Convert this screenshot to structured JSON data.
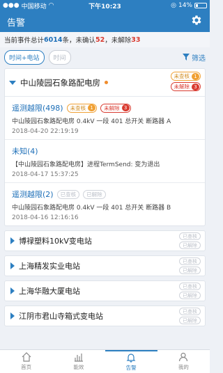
{
  "status": {
    "carrier": "中国移动",
    "time": "下午10:23",
    "battery": "14%"
  },
  "header": {
    "title": "告警"
  },
  "summary": {
    "prefix": "当前事件总计",
    "total": "6014",
    "unit1": "条，未确认",
    "unconfirmed": "52",
    "mid": "，未解除",
    "unresolved": "33"
  },
  "filters": {
    "chip1": "时间+电站",
    "chip2": "时间",
    "filter_label": "筛选"
  },
  "expanded": {
    "station": "中山陵园石象路配电房",
    "badge_unchecked": "未查核",
    "badge_unchecked_count": "1",
    "badge_unresolved": "未解除",
    "badge_unresolved_count": "3",
    "events": [
      {
        "title": "遥测越限(498)",
        "b1": "未查核",
        "b1n": "1",
        "b2": "未解除",
        "b2n": "3",
        "desc": "中山陵园石象路配电房 0.4kV 一段 401 总开关 断路器 A",
        "time": "2018-04-20 22:19:19"
      },
      {
        "title": "未知(4)",
        "desc": "【中山陵园石象路配电房】进程TermSend: 变为退出",
        "time": "2018-04-17 15:37:25"
      },
      {
        "title": "遥测越限(2)",
        "b1": "已查核",
        "b2": "已解除",
        "desc": "中山陵园石象路配电房 0.4kV 一段 401 总开关 断路器 B",
        "time": "2018-04-16 12:16:16"
      }
    ]
  },
  "stations": [
    {
      "name": "博禄塑料10kV变电站",
      "b1": "已查核",
      "b2": "已解除"
    },
    {
      "name": "上海精发实业电站",
      "b1": "已查核",
      "b2": "已解除"
    },
    {
      "name": "上海华融大厦电站",
      "b1": "已查核",
      "b2": "已解除"
    },
    {
      "name": "江阴市君山寺箱式变电站",
      "b1": "已查核",
      "b2": "已解除"
    }
  ],
  "tabs": [
    "首页",
    "能效",
    "告警",
    "我的"
  ],
  "colors": {
    "primary": "#2d7fc1",
    "alert_red": "#d93a2f",
    "warn_orange": "#f0a033"
  }
}
